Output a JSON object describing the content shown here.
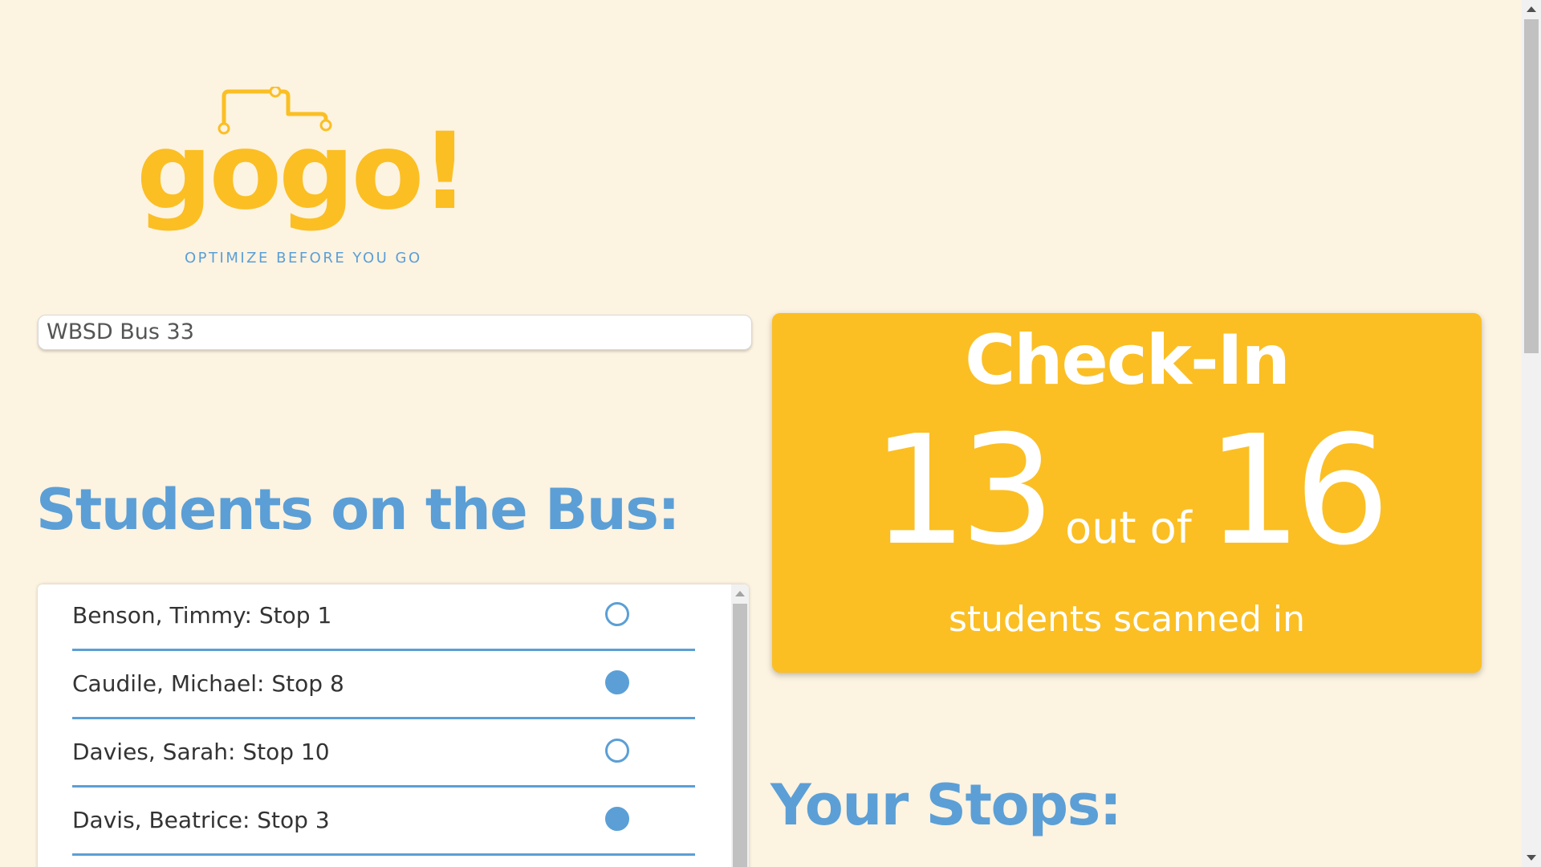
{
  "logo": {
    "wordmark": "gogo!",
    "tagline": "OPTIMIZE BEFORE YOU GO",
    "wordmark_color": "#fbbf24",
    "tagline_color": "#5b9fd6"
  },
  "bus_field": {
    "value": "WBSD Bus 33"
  },
  "students": {
    "heading": "Students on the Bus:",
    "items": [
      {
        "label": "Benson, Timmy: Stop 1",
        "scanned": false
      },
      {
        "label": "Caudile, Michael: Stop 8",
        "scanned": true
      },
      {
        "label": "Davies, Sarah: Stop 10",
        "scanned": false
      },
      {
        "label": "Davis, Beatrice: Stop 3",
        "scanned": true
      }
    ]
  },
  "checkin": {
    "title": "Check-In",
    "scanned": "13",
    "out_of_label": "out of",
    "total": "16",
    "subtitle": "students scanned in"
  },
  "stops": {
    "heading": "Your Stops:"
  },
  "colors": {
    "background": "#fdf3e1",
    "accent_yellow": "#fbbf24",
    "accent_blue": "#5b9fd6"
  }
}
